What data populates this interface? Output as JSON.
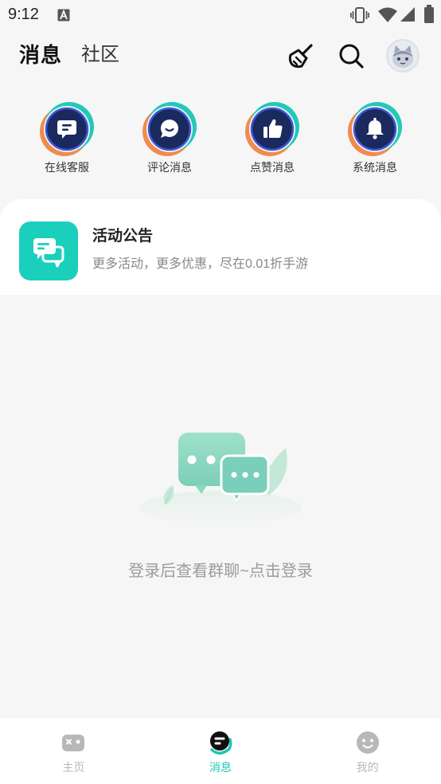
{
  "status_bar": {
    "time": "9:12",
    "icons": [
      "notification-a-icon",
      "vibrate-icon",
      "wifi-icon",
      "signal-icon",
      "battery-icon"
    ]
  },
  "header": {
    "tabs": [
      {
        "label": "消息",
        "active": true
      },
      {
        "label": "社区",
        "active": false
      }
    ],
    "actions": [
      {
        "icon": "broom-icon"
      },
      {
        "icon": "search-icon"
      },
      {
        "icon": "avatar"
      }
    ]
  },
  "quick_actions": [
    {
      "label": "在线客服",
      "icon": "customer-service-icon"
    },
    {
      "label": "评论消息",
      "icon": "comment-icon"
    },
    {
      "label": "点赞消息",
      "icon": "thumbs-up-icon"
    },
    {
      "label": "系统消息",
      "icon": "bell-icon"
    }
  ],
  "announcement": {
    "title": "活动公告",
    "subtitle": "更多活动，更多优惠，尽在0.01折手游",
    "icon": "chat-bubbles-icon"
  },
  "empty_state": {
    "text": "登录后查看群聊~点击登录",
    "illustration": "chat-bubbles-illustration"
  },
  "bottom_nav": [
    {
      "label": "主页",
      "icon": "gamepad-icon",
      "active": false
    },
    {
      "label": "消息",
      "icon": "message-icon",
      "active": true
    },
    {
      "label": "我的",
      "icon": "smiley-icon",
      "active": false
    }
  ],
  "theme": {
    "accent": "#1cc8b5",
    "navy": "#1b2a5e",
    "ring_blue": "#3f58d8",
    "orange": "#f08b4f",
    "ring_teal": "#22c9b7",
    "card_icon": "#1ad0bc",
    "bubble_large": "#8ad8c1",
    "bubble_small": "#79cfb9",
    "leaf": "#c4e8d7",
    "inactive": "#b8b8b8",
    "page_bg": "#f6f6f6"
  }
}
